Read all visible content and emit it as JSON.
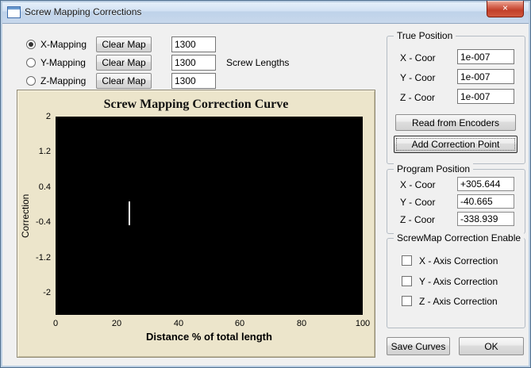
{
  "window": {
    "title": "Screw Mapping Corrections",
    "close_glyph": "×"
  },
  "mapping": {
    "screw_lengths_label": "Screw Lengths",
    "rows": [
      {
        "label": "X-Mapping",
        "selected": true,
        "clear_button": "Clear Map",
        "length": "1300"
      },
      {
        "label": "Y-Mapping",
        "selected": false,
        "clear_button": "Clear Map",
        "length": "1300"
      },
      {
        "label": "Z-Mapping",
        "selected": false,
        "clear_button": "Clear Map",
        "length": "1300"
      }
    ]
  },
  "chart_data": {
    "type": "line",
    "title": "Screw Mapping Correction Curve",
    "xlabel": "Distance % of total length",
    "ylabel": "Correction",
    "xlim": [
      0,
      100
    ],
    "ylim": [
      -2.5,
      2
    ],
    "x_ticks": [
      "0",
      "20",
      "40",
      "60",
      "80",
      "100"
    ],
    "y_ticks": [
      "2",
      "1.2",
      "0.4",
      "-0.4",
      "-1.2",
      "-2"
    ],
    "grid": false,
    "plot_background": "#000000",
    "panel_background": "#ece5cb",
    "series": [
      {
        "name": "position-cursor",
        "type": "vertical-marker",
        "x": [
          24
        ],
        "y": [
          -0.2
        ],
        "color": "#ffffff"
      }
    ]
  },
  "true_position": {
    "title": "True Position",
    "fields": [
      {
        "label": "X - Coor",
        "value": "1e-007"
      },
      {
        "label": "Y - Coor",
        "value": "1e-007"
      },
      {
        "label": "Z - Coor",
        "value": "1e-007"
      }
    ],
    "read_encoders_button": "Read from Encoders",
    "add_point_button": "Add Correction Point"
  },
  "program_position": {
    "title": "Program Position",
    "fields": [
      {
        "label": "X - Coor",
        "value": "+305.644"
      },
      {
        "label": "Y - Coor",
        "value": "-40.665"
      },
      {
        "label": "Z - Coor",
        "value": "-338.939"
      }
    ]
  },
  "correction_enable": {
    "title": "ScrewMap Correction Enable",
    "checkboxes": [
      {
        "label": "X - Axis Correction",
        "checked": false
      },
      {
        "label": "Y - Axis Correction",
        "checked": false
      },
      {
        "label": "Z - Axis Correction",
        "checked": false
      }
    ]
  },
  "footer": {
    "save_curves_button": "Save Curves",
    "ok_button": "OK"
  }
}
